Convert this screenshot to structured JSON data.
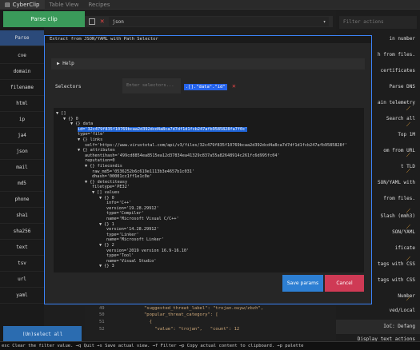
{
  "titlebar": {
    "tabs": [
      {
        "label": "CyberClip",
        "active": true
      },
      {
        "label": "Table View",
        "active": false
      },
      {
        "label": "Recipes",
        "active": false
      }
    ]
  },
  "left_panel": {
    "parse_button": "Parse clip",
    "selected_label": "Parse",
    "items": [
      "cve",
      "domain",
      "filename",
      "html",
      "ip",
      "ja4",
      "json",
      "mail",
      "md5",
      "phone",
      "sha1",
      "sha256",
      "text",
      "tsv",
      "url",
      "yaml"
    ],
    "bottom_button": "(Un)select all"
  },
  "toolbar": {
    "language": "json",
    "save_icon": "floppy-icon",
    "close_icon": "x-icon"
  },
  "right_panel": {
    "filter_placeholder": "Filter actions",
    "items": [
      "in number",
      "h from files.",
      "certificates",
      "Parse DNS",
      "ain telemetry",
      "Search all",
      "Top 1M",
      "om from URL",
      "t TLD",
      "SON/YAML with",
      "from files.",
      "Slash (mmh3)",
      "SON/YAML",
      "ificate",
      "tags with CSS",
      "tags with CSS",
      "Number",
      "ved/Local",
      "IoC: Defang",
      "Display text actions"
    ]
  },
  "modal": {
    "title": "Extract from JSON/YAML with Path Selector",
    "help_label": "Help",
    "selectors_label": "Selectors",
    "selector_placeholder": "Enter selectors...",
    "selector_value": ".[].\"data\".\"id\"",
    "save_label": "Save params",
    "cancel_label": "Cancel",
    "tree": [
      {
        "indent": 0,
        "text": "▼ []"
      },
      {
        "indent": 1,
        "text": "▼ {} 0"
      },
      {
        "indent": 2,
        "text": "▼ {} data"
      },
      {
        "indent": 3,
        "text": "id='32c479f835f10769bcaa2d392dcd4a8ca7d7df1d1fcb247afb9585828fa7f0c'",
        "selected": true
      },
      {
        "indent": 3,
        "text": "type='file'"
      },
      {
        "indent": 3,
        "text": "▼ {} links"
      },
      {
        "indent": 4,
        "text": "self='https://www.virustotal.com/api/v3/files/32c479f835f10769bcaa2d392dcd4a8ca7d7df1d1fcb247afb9585828f'"
      },
      {
        "indent": 3,
        "text": "▼ {} attributes"
      },
      {
        "indent": 4,
        "text": "authentihash='499cd8854ea8515ea12d37834ea41329c837a55a82648914c261fc6d995fc04'"
      },
      {
        "indent": 4,
        "text": "reputation=0"
      },
      {
        "indent": 4,
        "text": "▼ {} filecondis"
      },
      {
        "indent": 5,
        "text": "raw_md5='0536252b6c619e1113b3e4657b1c031'"
      },
      {
        "indent": 5,
        "text": "dhash='00001cc1ff1e1c0e'"
      },
      {
        "indent": 4,
        "text": "▼ {} detectiteasy"
      },
      {
        "indent": 5,
        "text": "filetype='PE32'"
      },
      {
        "indent": 5,
        "text": "▼ [] values"
      },
      {
        "indent": 6,
        "text": "▼ {} 0"
      },
      {
        "indent": 7,
        "text": "info='C++'"
      },
      {
        "indent": 7,
        "text": "version='19.28.29912'"
      },
      {
        "indent": 7,
        "text": "type='Compiler'"
      },
      {
        "indent": 7,
        "text": "name='Microsoft Visual C/C++'"
      },
      {
        "indent": 6,
        "text": "▼ {} 1"
      },
      {
        "indent": 7,
        "text": "version='14.28.29912'"
      },
      {
        "indent": 7,
        "text": "type='Linker'"
      },
      {
        "indent": 7,
        "text": "name='Microsoft Linker'"
      },
      {
        "indent": 6,
        "text": "▼ {} 2"
      },
      {
        "indent": 7,
        "text": "version='2019 version 16.9-16.10'"
      },
      {
        "indent": 7,
        "text": "type='Tool'"
      },
      {
        "indent": 7,
        "text": "name='Visual Studio'"
      },
      {
        "indent": 6,
        "text": "▼ {} 3"
      }
    ]
  },
  "editor_bottom": {
    "line_numbers": [
      "49",
      "50",
      "51",
      "52"
    ],
    "code": [
      "\"suggested_threat_label\": \"trojan.ouyw/zbzh\",",
      "\"popular_threat_category\": [",
      "  {",
      "    \"value\": \"trojan\",   \"count\": 12"
    ]
  },
  "statusbar": {
    "text": "esc Clear the filter value.   →q Quit   →s Save actual view.   →f Filter   →p Copy actual content to clipboard.                                   →p palette"
  }
}
